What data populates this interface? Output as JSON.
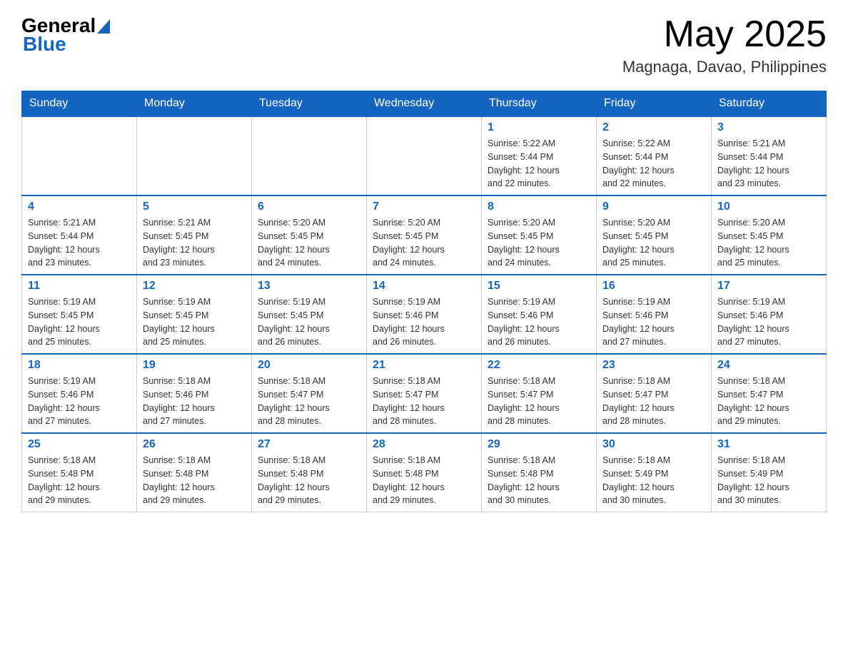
{
  "header": {
    "logo_general": "General",
    "logo_blue": "Blue",
    "month_title": "May 2025",
    "location": "Magnaga, Davao, Philippines"
  },
  "weekdays": [
    "Sunday",
    "Monday",
    "Tuesday",
    "Wednesday",
    "Thursday",
    "Friday",
    "Saturday"
  ],
  "weeks": [
    [
      {
        "day": "",
        "info": ""
      },
      {
        "day": "",
        "info": ""
      },
      {
        "day": "",
        "info": ""
      },
      {
        "day": "",
        "info": ""
      },
      {
        "day": "1",
        "info": "Sunrise: 5:22 AM\nSunset: 5:44 PM\nDaylight: 12 hours\nand 22 minutes."
      },
      {
        "day": "2",
        "info": "Sunrise: 5:22 AM\nSunset: 5:44 PM\nDaylight: 12 hours\nand 22 minutes."
      },
      {
        "day": "3",
        "info": "Sunrise: 5:21 AM\nSunset: 5:44 PM\nDaylight: 12 hours\nand 23 minutes."
      }
    ],
    [
      {
        "day": "4",
        "info": "Sunrise: 5:21 AM\nSunset: 5:44 PM\nDaylight: 12 hours\nand 23 minutes."
      },
      {
        "day": "5",
        "info": "Sunrise: 5:21 AM\nSunset: 5:45 PM\nDaylight: 12 hours\nand 23 minutes."
      },
      {
        "day": "6",
        "info": "Sunrise: 5:20 AM\nSunset: 5:45 PM\nDaylight: 12 hours\nand 24 minutes."
      },
      {
        "day": "7",
        "info": "Sunrise: 5:20 AM\nSunset: 5:45 PM\nDaylight: 12 hours\nand 24 minutes."
      },
      {
        "day": "8",
        "info": "Sunrise: 5:20 AM\nSunset: 5:45 PM\nDaylight: 12 hours\nand 24 minutes."
      },
      {
        "day": "9",
        "info": "Sunrise: 5:20 AM\nSunset: 5:45 PM\nDaylight: 12 hours\nand 25 minutes."
      },
      {
        "day": "10",
        "info": "Sunrise: 5:20 AM\nSunset: 5:45 PM\nDaylight: 12 hours\nand 25 minutes."
      }
    ],
    [
      {
        "day": "11",
        "info": "Sunrise: 5:19 AM\nSunset: 5:45 PM\nDaylight: 12 hours\nand 25 minutes."
      },
      {
        "day": "12",
        "info": "Sunrise: 5:19 AM\nSunset: 5:45 PM\nDaylight: 12 hours\nand 25 minutes."
      },
      {
        "day": "13",
        "info": "Sunrise: 5:19 AM\nSunset: 5:45 PM\nDaylight: 12 hours\nand 26 minutes."
      },
      {
        "day": "14",
        "info": "Sunrise: 5:19 AM\nSunset: 5:46 PM\nDaylight: 12 hours\nand 26 minutes."
      },
      {
        "day": "15",
        "info": "Sunrise: 5:19 AM\nSunset: 5:46 PM\nDaylight: 12 hours\nand 26 minutes."
      },
      {
        "day": "16",
        "info": "Sunrise: 5:19 AM\nSunset: 5:46 PM\nDaylight: 12 hours\nand 27 minutes."
      },
      {
        "day": "17",
        "info": "Sunrise: 5:19 AM\nSunset: 5:46 PM\nDaylight: 12 hours\nand 27 minutes."
      }
    ],
    [
      {
        "day": "18",
        "info": "Sunrise: 5:19 AM\nSunset: 5:46 PM\nDaylight: 12 hours\nand 27 minutes."
      },
      {
        "day": "19",
        "info": "Sunrise: 5:18 AM\nSunset: 5:46 PM\nDaylight: 12 hours\nand 27 minutes."
      },
      {
        "day": "20",
        "info": "Sunrise: 5:18 AM\nSunset: 5:47 PM\nDaylight: 12 hours\nand 28 minutes."
      },
      {
        "day": "21",
        "info": "Sunrise: 5:18 AM\nSunset: 5:47 PM\nDaylight: 12 hours\nand 28 minutes."
      },
      {
        "day": "22",
        "info": "Sunrise: 5:18 AM\nSunset: 5:47 PM\nDaylight: 12 hours\nand 28 minutes."
      },
      {
        "day": "23",
        "info": "Sunrise: 5:18 AM\nSunset: 5:47 PM\nDaylight: 12 hours\nand 28 minutes."
      },
      {
        "day": "24",
        "info": "Sunrise: 5:18 AM\nSunset: 5:47 PM\nDaylight: 12 hours\nand 29 minutes."
      }
    ],
    [
      {
        "day": "25",
        "info": "Sunrise: 5:18 AM\nSunset: 5:48 PM\nDaylight: 12 hours\nand 29 minutes."
      },
      {
        "day": "26",
        "info": "Sunrise: 5:18 AM\nSunset: 5:48 PM\nDaylight: 12 hours\nand 29 minutes."
      },
      {
        "day": "27",
        "info": "Sunrise: 5:18 AM\nSunset: 5:48 PM\nDaylight: 12 hours\nand 29 minutes."
      },
      {
        "day": "28",
        "info": "Sunrise: 5:18 AM\nSunset: 5:48 PM\nDaylight: 12 hours\nand 29 minutes."
      },
      {
        "day": "29",
        "info": "Sunrise: 5:18 AM\nSunset: 5:48 PM\nDaylight: 12 hours\nand 30 minutes."
      },
      {
        "day": "30",
        "info": "Sunrise: 5:18 AM\nSunset: 5:49 PM\nDaylight: 12 hours\nand 30 minutes."
      },
      {
        "day": "31",
        "info": "Sunrise: 5:18 AM\nSunset: 5:49 PM\nDaylight: 12 hours\nand 30 minutes."
      }
    ]
  ]
}
